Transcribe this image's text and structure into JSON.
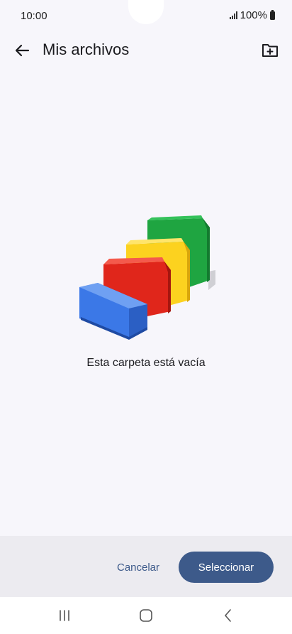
{
  "status_bar": {
    "time": "10:00",
    "battery": "100%"
  },
  "app_bar": {
    "title": "Mis archivos"
  },
  "empty_state": {
    "message": "Esta carpeta está vacía"
  },
  "actions": {
    "cancel_label": "Cancelar",
    "select_label": "Seleccionar"
  },
  "colors": {
    "accent": "#3d5a8a",
    "background": "#f7f6fb",
    "bottom_bar": "#ecebf0",
    "folder_blue": "#3b78e7",
    "folder_red": "#e0261b",
    "folder_yellow": "#fcd21f",
    "folder_green": "#1fa541"
  },
  "icons": [
    "arrow-left-icon",
    "new-folder-icon",
    "signal-icon",
    "battery-icon",
    "recents-icon",
    "home-icon",
    "back-nav-icon"
  ]
}
